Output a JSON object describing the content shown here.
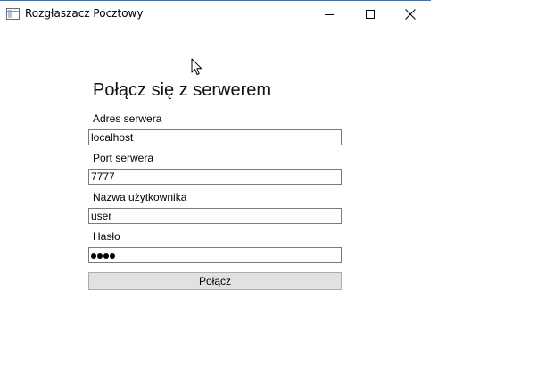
{
  "window": {
    "title": "Rozgłaszacz Pocztowy",
    "app_icon": "window-app-icon",
    "controls": {
      "minimize_icon": "minimize-icon",
      "maximize_icon": "maximize-icon",
      "close_icon": "close-icon"
    }
  },
  "form": {
    "heading": "Połącz się z serwerem",
    "address": {
      "label": "Adres serwera",
      "value": "localhost"
    },
    "port": {
      "label": "Port serwera",
      "value": "7777"
    },
    "username": {
      "label": "Nazwa użytkownika",
      "value": "user"
    },
    "password": {
      "label": "Hasło",
      "masked_length": 4
    },
    "connect_label": "Połącz"
  },
  "colors": {
    "window_border": "#1f78d1",
    "button_bg": "#e1e1e1",
    "textbox_border": "#7a7a7a"
  }
}
